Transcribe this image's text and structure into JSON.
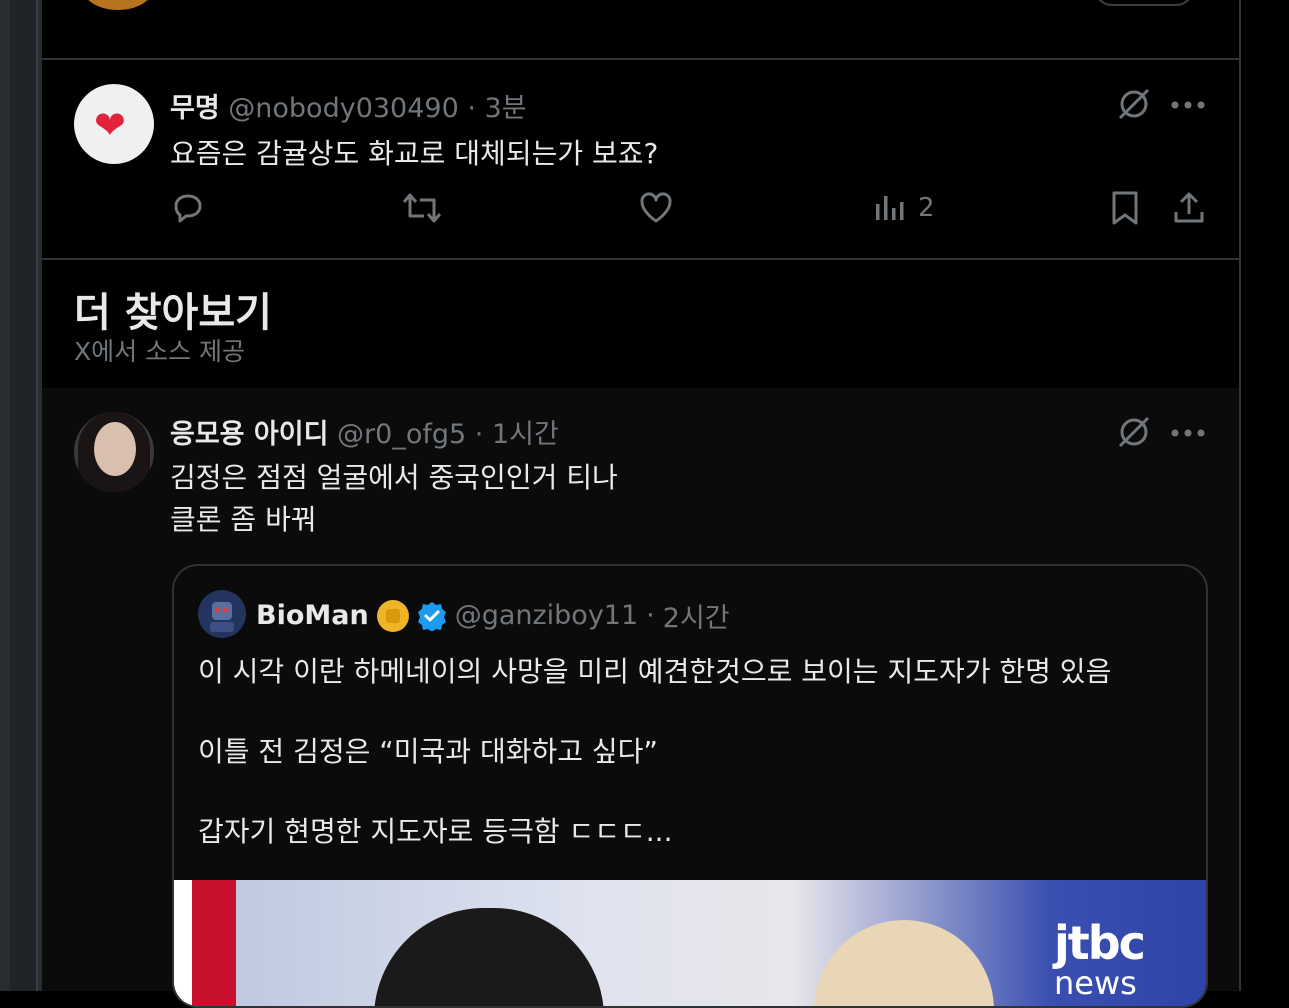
{
  "reply": {
    "name": "무명",
    "handle": "@nobody030490",
    "separator": "·",
    "time": "3분",
    "text": "요즘은 감귤상도 화교로 대체되는가 보죠?",
    "views": "2"
  },
  "section": {
    "title": "더 찾아보기",
    "subtitle": "X에서 소스 제공"
  },
  "post": {
    "name": "응모용 아이디",
    "handle": "@r0_ofg5",
    "separator": "·",
    "time": "1시간",
    "lines": [
      "김정은 점점 얼굴에서 중국인인거 티나",
      "클론 좀 바꿔"
    ]
  },
  "quote": {
    "name": "BioMan",
    "handle": "@ganziboy11",
    "separator": "·",
    "time": "2시간",
    "lines": [
      "이 시각 이란 하메네이의 사망을 미리 예견한것으로 보이는 지도자가 한명 있음",
      "이틀 전 김정은 “미국과 대화하고 싶다”",
      "갑자기 현명한 지도자로 등극함 ㄷㄷㄷ..."
    ],
    "media_brand": "jtbc",
    "media_brand_sub": "news"
  },
  "colors": {
    "background": "#000000",
    "text": "#e7e9ea",
    "muted": "#71767b",
    "border": "#2f3336",
    "verified": "#1d9bf0",
    "heart": "#e0223a"
  },
  "icons": {
    "reply": "reply-icon",
    "repost": "repost-icon",
    "like": "like-icon",
    "views": "views-icon",
    "bookmark": "bookmark-icon",
    "share": "share-icon",
    "grok": "grok-icon",
    "more": "more-icon"
  }
}
